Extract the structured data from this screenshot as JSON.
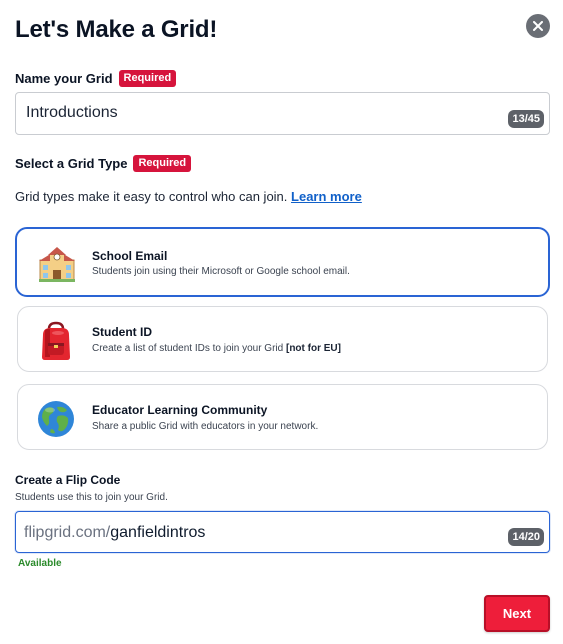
{
  "dialog": {
    "title": "Let's Make a Grid!",
    "close_icon": "close-icon"
  },
  "name_field": {
    "label": "Name your Grid",
    "required_badge": "Required",
    "value": "Introductions",
    "counter": "13/45"
  },
  "grid_type": {
    "label": "Select a Grid Type",
    "required_badge": "Required",
    "description": "Grid types make it easy to control who can join.",
    "learn_more": "Learn more",
    "options": [
      {
        "title": "School Email",
        "subtitle": "Students join using their Microsoft or Google school email.",
        "icon": "school-icon",
        "selected": true
      },
      {
        "title": "Student ID",
        "subtitle": "Create a list of student IDs to join your Grid",
        "subtitle_bold": "[not for EU]",
        "icon": "backpack-icon",
        "selected": false
      },
      {
        "title": "Educator Learning Community",
        "subtitle": "Share a public Grid with educators in your network.",
        "icon": "globe-icon",
        "selected": false
      }
    ]
  },
  "flip_code": {
    "label": "Create a Flip Code",
    "help": "Students use this to join your Grid.",
    "prefix": "flipgrid.com/",
    "value": "ganfieldintros",
    "counter": "14/20",
    "status": "Available"
  },
  "actions": {
    "next_label": "Next"
  },
  "colors": {
    "required_badge": "#d6143c",
    "selected_border": "#2a64d4",
    "link": "#1060c9",
    "available": "#2a8a2a",
    "next_button": "#ee1e3a"
  }
}
